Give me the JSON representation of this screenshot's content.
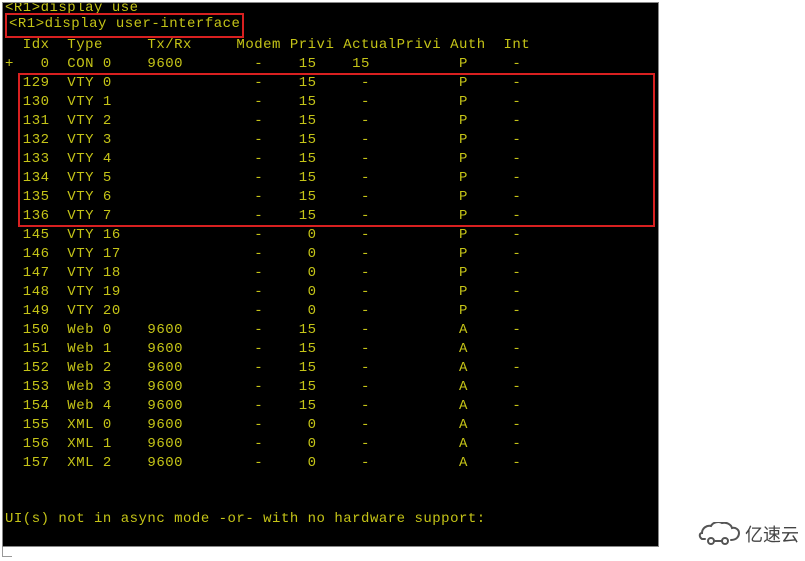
{
  "prompt1": "<R1>display use",
  "prompt2": "<R1>display user-interface",
  "headers": {
    "idx": "Idx",
    "type": "Type",
    "txrx": "Tx/Rx",
    "modem": "Modem",
    "privi": "Privi",
    "actualprivi": "ActualPrivi",
    "auth": "Auth",
    "int": "Int"
  },
  "rows": [
    {
      "prefix": "+",
      "idx": "0",
      "type": "CON 0",
      "txrx": "9600",
      "modem": "-",
      "privi": "15",
      "actualprivi": "15",
      "auth": "P",
      "int": "-"
    },
    {
      "prefix": " ",
      "idx": "129",
      "type": "VTY 0",
      "txrx": "",
      "modem": "-",
      "privi": "15",
      "actualprivi": "-",
      "auth": "P",
      "int": "-"
    },
    {
      "prefix": " ",
      "idx": "130",
      "type": "VTY 1",
      "txrx": "",
      "modem": "-",
      "privi": "15",
      "actualprivi": "-",
      "auth": "P",
      "int": "-"
    },
    {
      "prefix": " ",
      "idx": "131",
      "type": "VTY 2",
      "txrx": "",
      "modem": "-",
      "privi": "15",
      "actualprivi": "-",
      "auth": "P",
      "int": "-"
    },
    {
      "prefix": " ",
      "idx": "132",
      "type": "VTY 3",
      "txrx": "",
      "modem": "-",
      "privi": "15",
      "actualprivi": "-",
      "auth": "P",
      "int": "-"
    },
    {
      "prefix": " ",
      "idx": "133",
      "type": "VTY 4",
      "txrx": "",
      "modem": "-",
      "privi": "15",
      "actualprivi": "-",
      "auth": "P",
      "int": "-"
    },
    {
      "prefix": " ",
      "idx": "134",
      "type": "VTY 5",
      "txrx": "",
      "modem": "-",
      "privi": "15",
      "actualprivi": "-",
      "auth": "P",
      "int": "-"
    },
    {
      "prefix": " ",
      "idx": "135",
      "type": "VTY 6",
      "txrx": "",
      "modem": "-",
      "privi": "15",
      "actualprivi": "-",
      "auth": "P",
      "int": "-"
    },
    {
      "prefix": " ",
      "idx": "136",
      "type": "VTY 7",
      "txrx": "",
      "modem": "-",
      "privi": "15",
      "actualprivi": "-",
      "auth": "P",
      "int": "-"
    },
    {
      "prefix": " ",
      "idx": "145",
      "type": "VTY 16",
      "txrx": "",
      "modem": "-",
      "privi": "0",
      "actualprivi": "-",
      "auth": "P",
      "int": "-"
    },
    {
      "prefix": " ",
      "idx": "146",
      "type": "VTY 17",
      "txrx": "",
      "modem": "-",
      "privi": "0",
      "actualprivi": "-",
      "auth": "P",
      "int": "-"
    },
    {
      "prefix": " ",
      "idx": "147",
      "type": "VTY 18",
      "txrx": "",
      "modem": "-",
      "privi": "0",
      "actualprivi": "-",
      "auth": "P",
      "int": "-"
    },
    {
      "prefix": " ",
      "idx": "148",
      "type": "VTY 19",
      "txrx": "",
      "modem": "-",
      "privi": "0",
      "actualprivi": "-",
      "auth": "P",
      "int": "-"
    },
    {
      "prefix": " ",
      "idx": "149",
      "type": "VTY 20",
      "txrx": "",
      "modem": "-",
      "privi": "0",
      "actualprivi": "-",
      "auth": "P",
      "int": "-"
    },
    {
      "prefix": " ",
      "idx": "150",
      "type": "Web 0",
      "txrx": "9600",
      "modem": "-",
      "privi": "15",
      "actualprivi": "-",
      "auth": "A",
      "int": "-"
    },
    {
      "prefix": " ",
      "idx": "151",
      "type": "Web 1",
      "txrx": "9600",
      "modem": "-",
      "privi": "15",
      "actualprivi": "-",
      "auth": "A",
      "int": "-"
    },
    {
      "prefix": " ",
      "idx": "152",
      "type": "Web 2",
      "txrx": "9600",
      "modem": "-",
      "privi": "15",
      "actualprivi": "-",
      "auth": "A",
      "int": "-"
    },
    {
      "prefix": " ",
      "idx": "153",
      "type": "Web 3",
      "txrx": "9600",
      "modem": "-",
      "privi": "15",
      "actualprivi": "-",
      "auth": "A",
      "int": "-"
    },
    {
      "prefix": " ",
      "idx": "154",
      "type": "Web 4",
      "txrx": "9600",
      "modem": "-",
      "privi": "15",
      "actualprivi": "-",
      "auth": "A",
      "int": "-"
    },
    {
      "prefix": " ",
      "idx": "155",
      "type": "XML 0",
      "txrx": "9600",
      "modem": "-",
      "privi": "0",
      "actualprivi": "-",
      "auth": "A",
      "int": "-"
    },
    {
      "prefix": " ",
      "idx": "156",
      "type": "XML 1",
      "txrx": "9600",
      "modem": "-",
      "privi": "0",
      "actualprivi": "-",
      "auth": "A",
      "int": "-"
    },
    {
      "prefix": " ",
      "idx": "157",
      "type": "XML 2",
      "txrx": "9600",
      "modem": "-",
      "privi": "0",
      "actualprivi": "-",
      "auth": "A",
      "int": "-"
    }
  ],
  "footer": "UI(s) not in async mode -or- with no hardware support:",
  "logo_text": "亿速云"
}
